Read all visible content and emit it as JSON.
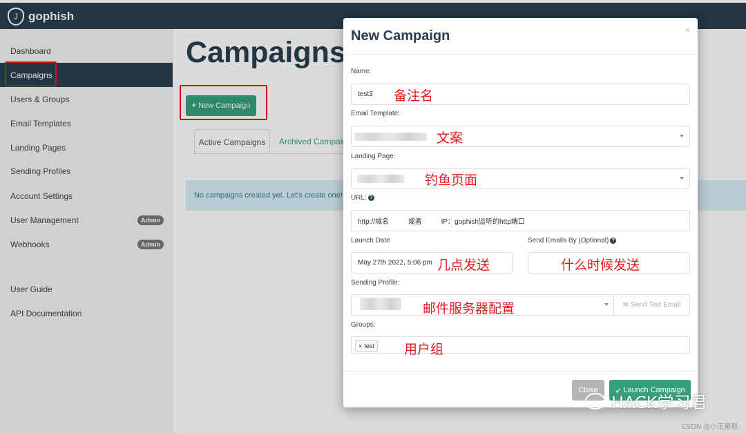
{
  "app": {
    "logo_text": "gophish"
  },
  "sidebar": {
    "items": [
      {
        "label": "Dashboard"
      },
      {
        "label": "Campaigns"
      },
      {
        "label": "Users & Groups"
      },
      {
        "label": "Email Templates"
      },
      {
        "label": "Landing Pages"
      },
      {
        "label": "Sending Profiles"
      },
      {
        "label": "Account Settings"
      },
      {
        "label": "User Management",
        "badge": "Admin"
      },
      {
        "label": "Webhooks",
        "badge": "Admin"
      },
      {
        "label": "User Guide"
      },
      {
        "label": "API Documentation"
      }
    ],
    "active_index": 1
  },
  "main": {
    "title": "Campaigns",
    "new_campaign_label": "New Campaign",
    "tabs": [
      {
        "label": "Active Campaigns"
      },
      {
        "label": "Archived Campaigns"
      }
    ],
    "empty_message": "No campaigns created yet. Let's create one!"
  },
  "modal": {
    "title": "New Campaign",
    "close_symbol": "×",
    "name_label": "Name:",
    "name_value": "test3",
    "template_label": "Email Template:",
    "landing_label": "Landing Page:",
    "url_label": "URL:",
    "url_value": "http://域名          或者          IP：gophish监听的http端口",
    "launch_date_label": "Launch Date",
    "launch_date_value": "May 27th 2022, 5:06 pm",
    "send_by_label": "Send Emails By (Optional)",
    "sending_profile_label": "Sending Profile:",
    "send_test_label": "Send Test Email",
    "groups_label": "Groups:",
    "group_chip": "test",
    "chip_remove": "×",
    "close_button": "Close",
    "launch_button": "Launch Campaign"
  },
  "annotations": {
    "name": "备注名",
    "template": "文案",
    "landing": "钓鱼页面",
    "launch_date": "几点发送",
    "send_by": "什么时候发送",
    "sending_profile": "邮件服务器配置",
    "groups": "用户组"
  },
  "watermark": {
    "main": "HACK学习君",
    "csdn": "CSDN @小王童鞋-"
  },
  "colors": {
    "navbar": "#283f50",
    "accent_green": "#37a07b",
    "annotation_red": "#e31b1b",
    "alert_bg": "#d9eef6"
  }
}
